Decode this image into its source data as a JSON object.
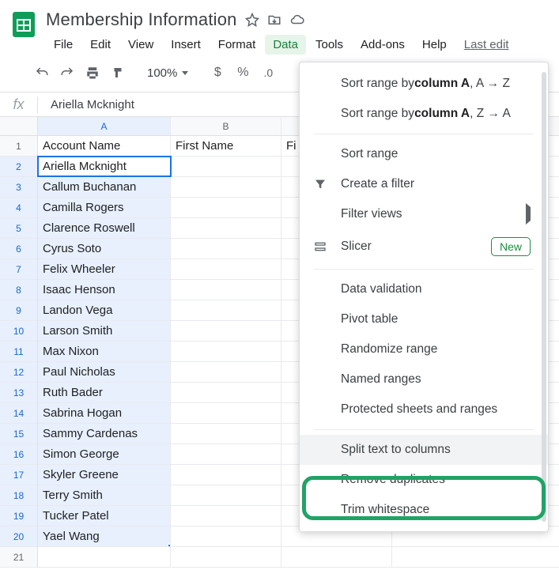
{
  "doc": {
    "title": "Membership Information"
  },
  "menubar": {
    "items": [
      "File",
      "Edit",
      "View",
      "Insert",
      "Format",
      "Data",
      "Tools",
      "Add-ons",
      "Help"
    ],
    "active_index": 5,
    "last_edit": "Last edit"
  },
  "toolbar": {
    "zoom": "100%",
    "currency": "$",
    "percent": "%",
    "decimals": ".0"
  },
  "formula_bar": {
    "label": "fx",
    "value": "Ariella Mcknight"
  },
  "columns": {
    "A": "A",
    "B": "B"
  },
  "headers": {
    "A": "Account Name",
    "B": "First Name",
    "C": "Fi"
  },
  "rows": [
    "Ariella Mcknight",
    "Callum Buchanan",
    "Camilla Rogers",
    "Clarence Roswell",
    "Cyrus Soto",
    "Felix Wheeler",
    "Isaac Henson",
    "Landon Vega",
    "Larson Smith",
    "Max Nixon",
    "Paul Nicholas",
    "Ruth Bader",
    "Sabrina Hogan",
    "Sammy Cardenas",
    "Simon George",
    "Skyler Greene",
    "Terry Smith",
    "Tucker Patel",
    "Yael Wang"
  ],
  "selected": {
    "row": 2,
    "col": "A",
    "range_start": 2,
    "range_end": 20
  },
  "data_menu": {
    "sort_az_prefix": "Sort range by ",
    "sort_az_col": "column A",
    "sort_az_suffix": ", A → Z",
    "sort_za_prefix": "Sort range by ",
    "sort_za_col": "column A",
    "sort_za_suffix": ", Z → A",
    "sort_range": "Sort range",
    "create_filter": "Create a filter",
    "filter_views": "Filter views",
    "slicer": "Slicer",
    "slicer_badge": "New",
    "data_validation": "Data validation",
    "pivot_table": "Pivot table",
    "randomize": "Randomize range",
    "named_ranges": "Named ranges",
    "protected": "Protected sheets and ranges",
    "split_text": "Split text to columns",
    "remove_dup": "Remove duplicates",
    "trim": "Trim whitespace"
  }
}
